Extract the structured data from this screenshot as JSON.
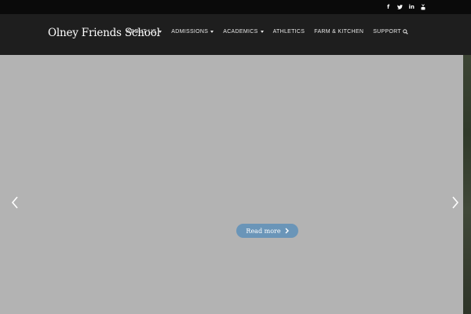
{
  "topbar": {
    "social": [
      {
        "name": "facebook-icon",
        "glyph": "f"
      },
      {
        "name": "twitter-icon",
        "glyph": "twitter"
      },
      {
        "name": "linkedin-icon",
        "glyph": "in"
      },
      {
        "name": "youtube-icon",
        "glyph": "youtube"
      }
    ]
  },
  "header": {
    "logo": "Olney Friends School",
    "menu": {
      "about": "ABOUT US",
      "admissions": "ADMISSIONS",
      "academics": "ACADEMICS",
      "athletics": "ATHLETICS",
      "farm": "FARM & KITCHEN",
      "support": "SUPPORT"
    },
    "search_icon": "search-icon"
  },
  "hero": {
    "read_more": "Read more",
    "prev_icon": "chevron-left-icon",
    "next_icon": "chevron-right-icon"
  },
  "colors": {
    "topbar": "#0a0a0a",
    "navbar": "#1e1e1e",
    "hero_bg": "#b3b3b3",
    "button": "#6a95b8"
  }
}
